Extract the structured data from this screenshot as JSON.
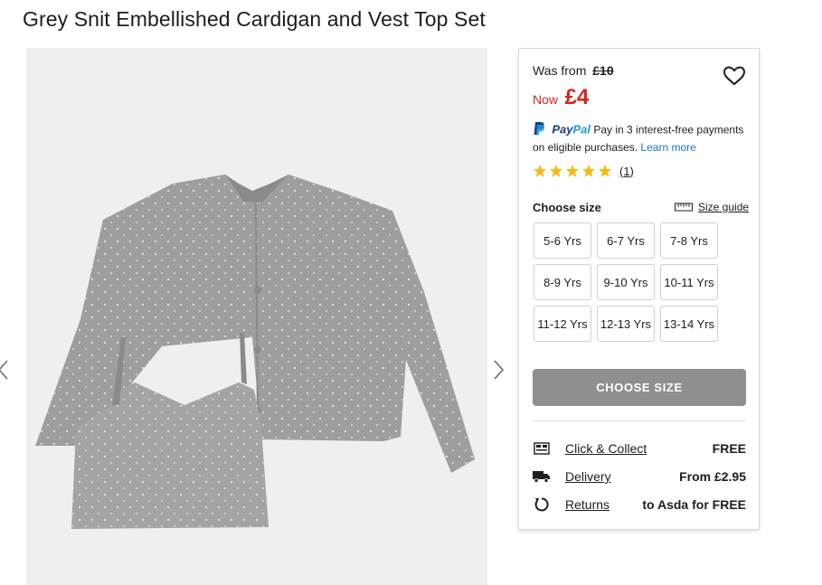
{
  "product": {
    "title": "Grey Snit Embellished Cardigan and Vest Top Set"
  },
  "gallery": {
    "image_alt": "Grey cardigan and vest top with sparkle embellishment",
    "prev_icon": "chevron-left-icon",
    "next_icon": "chevron-right-icon"
  },
  "pricing": {
    "was_label": "Was from",
    "was_price": "£10",
    "now_label": "Now",
    "now_price": "£4",
    "price_color": "#d2241f"
  },
  "paypal": {
    "brand": "PayPal",
    "brand_pay": "Pay",
    "brand_pal": "Pal",
    "text": "Pay in 3 interest-free payments on eligible purchases.",
    "learn_more": "Learn more"
  },
  "rating": {
    "stars": 5,
    "max": 5,
    "count": "(1)",
    "star_color": "#f5b917"
  },
  "sizes": {
    "label": "Choose size",
    "guide_label": "Size guide",
    "options": [
      "5-6 Yrs",
      "6-7 Yrs",
      "7-8 Yrs",
      "8-9 Yrs",
      "9-10 Yrs",
      "10-11 Yrs",
      "11-12 Yrs",
      "12-13 Yrs",
      "13-14 Yrs"
    ]
  },
  "cta": {
    "label": "CHOOSE SIZE",
    "color": "#8f8f8f"
  },
  "fulfilment": [
    {
      "icon": "store-icon",
      "label": "Click & Collect",
      "value": "FREE"
    },
    {
      "icon": "truck-icon",
      "label": "Delivery",
      "value": "From £2.95"
    },
    {
      "icon": "returns-icon",
      "label": "Returns",
      "value": "to Asda for FREE"
    }
  ]
}
